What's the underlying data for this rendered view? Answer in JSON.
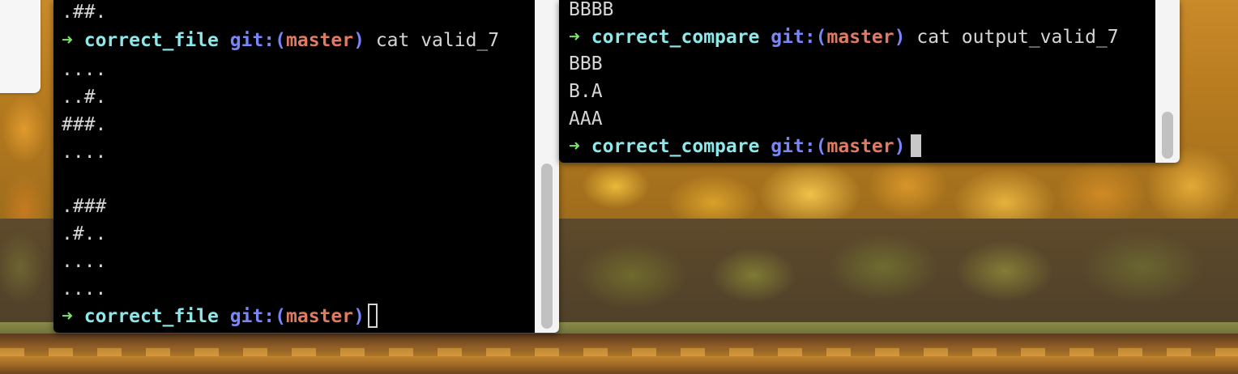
{
  "left_terminal": {
    "lines": [
      ".##.",
      "....",
      "..#.",
      "###.",
      "....",
      "",
      ".###",
      ".#..",
      "....",
      "...."
    ],
    "prompt1": {
      "arrow": "➜",
      "dir": "correct_file",
      "git": "git:(",
      "branch": "master",
      "git_close": ")",
      "command": "cat valid_7"
    },
    "prompt2": {
      "arrow": "➜",
      "dir": "correct_file",
      "git": "git:(",
      "branch": "master",
      "git_close": ")"
    }
  },
  "right_terminal": {
    "line0": "BBBB",
    "prompt1": {
      "arrow": "➜",
      "dir": "correct_compare",
      "git": "git:(",
      "branch": "master",
      "git_close": ")",
      "command": "cat output_valid_7"
    },
    "output": [
      "BBB",
      "B.A",
      "AAA"
    ],
    "prompt2": {
      "arrow": "➜",
      "dir": "correct_compare",
      "git": "git:(",
      "branch": "master",
      "git_close": ")"
    }
  },
  "colors": {
    "arrow": "#7ee26a",
    "dir": "#8ee8ea",
    "git": "#7a85f6",
    "branch": "#e07b63",
    "text": "#d6d6d6",
    "background": "#000000"
  },
  "icons": {
    "prompt": "right-arrow-icon",
    "cursor": "text-cursor-icon"
  }
}
